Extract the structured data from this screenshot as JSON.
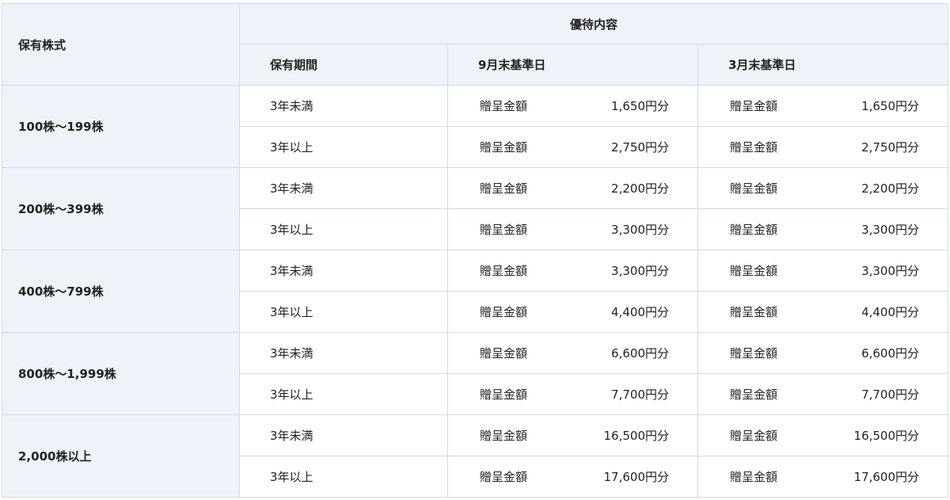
{
  "header": {
    "holding_label": "保有株式",
    "benefit_label": "優待内容",
    "period_label": "保有期間",
    "sep_label": "9月末基準日",
    "mar_label": "3月末基準日"
  },
  "rows": [
    {
      "shares": "100株～199株",
      "lines": [
        {
          "period": "3年未満",
          "sep_label": "贈呈金額",
          "sep_value": "1,650円分",
          "mar_label": "贈呈金額",
          "mar_value": "1,650円分"
        },
        {
          "period": "3年以上",
          "sep_label": "贈呈金額",
          "sep_value": "2,750円分",
          "mar_label": "贈呈金額",
          "mar_value": "2,750円分"
        }
      ]
    },
    {
      "shares": "200株～399株",
      "lines": [
        {
          "period": "3年未満",
          "sep_label": "贈呈金額",
          "sep_value": "2,200円分",
          "mar_label": "贈呈金額",
          "mar_value": "2,200円分"
        },
        {
          "period": "3年以上",
          "sep_label": "贈呈金額",
          "sep_value": "3,300円分",
          "mar_label": "贈呈金額",
          "mar_value": "3,300円分"
        }
      ]
    },
    {
      "shares": "400株～799株",
      "lines": [
        {
          "period": "3年未満",
          "sep_label": "贈呈金額",
          "sep_value": "3,300円分",
          "mar_label": "贈呈金額",
          "mar_value": "3,300円分"
        },
        {
          "period": "3年以上",
          "sep_label": "贈呈金額",
          "sep_value": "4,400円分",
          "mar_label": "贈呈金額",
          "mar_value": "4,400円分"
        }
      ]
    },
    {
      "shares": "800株～1,999株",
      "lines": [
        {
          "period": "3年未満",
          "sep_label": "贈呈金額",
          "sep_value": "6,600円分",
          "mar_label": "贈呈金額",
          "mar_value": "6,600円分"
        },
        {
          "period": "3年以上",
          "sep_label": "贈呈金額",
          "sep_value": "7,700円分",
          "mar_label": "贈呈金額",
          "mar_value": "7,700円分"
        }
      ]
    },
    {
      "shares": "2,000株以上",
      "lines": [
        {
          "period": "3年未満",
          "sep_label": "贈呈金額",
          "sep_value": "16,500円分",
          "mar_label": "贈呈金額",
          "mar_value": "16,500円分"
        },
        {
          "period": "3年以上",
          "sep_label": "贈呈金額",
          "sep_value": "17,600円分",
          "mar_label": "贈呈金額",
          "mar_value": "17,600円分"
        }
      ]
    }
  ]
}
